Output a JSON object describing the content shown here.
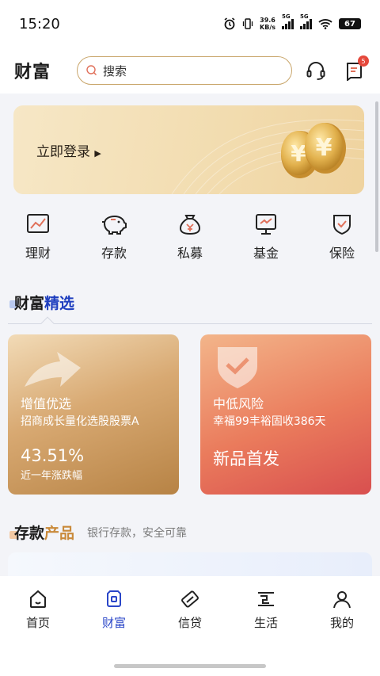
{
  "status": {
    "time": "15:20",
    "net_speed_value": "39.6",
    "net_speed_unit": "KB/s",
    "sim1": "5G",
    "sim2": "5G",
    "battery": "67"
  },
  "header": {
    "brand": "财富",
    "search_placeholder": "搜索",
    "message_badge": "5"
  },
  "banner": {
    "login_label": "立即登录"
  },
  "quick_menu": [
    {
      "label": "理财",
      "icon": "chart-icon"
    },
    {
      "label": "存款",
      "icon": "piggy-bank-icon"
    },
    {
      "label": "私募",
      "icon": "money-bag-icon"
    },
    {
      "label": "基金",
      "icon": "fund-screen-icon"
    },
    {
      "label": "保险",
      "icon": "shield-check-icon"
    }
  ],
  "featured": {
    "title_part1": "财富",
    "title_part2": "精选",
    "cards": [
      {
        "title": "增值优选",
        "subtitle": "招商成长量化选股股票A",
        "big": "43.51%",
        "note": "近一年涨跌幅"
      },
      {
        "title": "中低风险",
        "subtitle": "幸福99丰裕固收386天",
        "big": "新品首发",
        "note": ""
      }
    ]
  },
  "deposit": {
    "title_part1": "存款",
    "title_part2": "产品",
    "subtitle": "银行存款，安全可靠"
  },
  "tabbar": [
    {
      "label": "首页",
      "icon": "home-icon",
      "active": false
    },
    {
      "label": "财富",
      "icon": "wealth-icon",
      "active": true
    },
    {
      "label": "信贷",
      "icon": "credit-icon",
      "active": false
    },
    {
      "label": "生活",
      "icon": "life-icon",
      "active": false
    },
    {
      "label": "我的",
      "icon": "profile-icon",
      "active": false
    }
  ],
  "colors": {
    "accent_blue": "#2a46c8",
    "gold": "#c9a66b",
    "badge_red": "#e5483b"
  }
}
